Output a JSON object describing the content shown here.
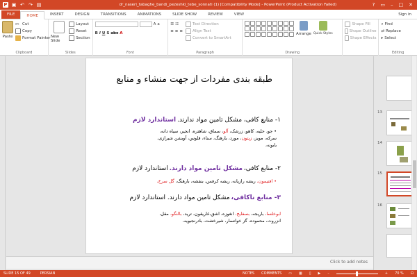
{
  "window": {
    "title": "dr_naseri_tabaghe_bandi_pezeshki_tebe_sonnati (1) [Compatibility Mode] - PowerPoint (Product Activation Failed)",
    "controls": [
      "?",
      "▭",
      "–",
      "□",
      "✕"
    ]
  },
  "quick_access": {
    "icons": [
      "save-icon",
      "undo-icon",
      "redo-icon",
      "present-icon"
    ]
  },
  "tabs": [
    "FILE",
    "HOME",
    "INSERT",
    "DESIGN",
    "TRANSITIONS",
    "ANIMATIONS",
    "SLIDE SHOW",
    "REVIEW",
    "VIEW"
  ],
  "active_tab": "HOME",
  "sign_in": "Sign in",
  "ribbon": {
    "clipboard": {
      "paste": "Paste",
      "cut": "Cut",
      "copy": "Copy",
      "format_painter": "Format Painter",
      "label": "Clipboard"
    },
    "slides": {
      "new_slide": "New Slide",
      "layout": "Layout",
      "reset": "Reset",
      "section": "Section",
      "label": "Slides"
    },
    "font": {
      "label": "Font"
    },
    "paragraph": {
      "text_direction": "Text Direction",
      "align_text": "Align Text",
      "convert_smartart": "Convert to SmartArt",
      "label": "Paragraph"
    },
    "drawing": {
      "arrange": "Arrange",
      "quick_styles": "Quick Styles",
      "shape_fill": "Shape Fill",
      "shape_outline": "Shape Outline",
      "shape_effects": "Shape Effects",
      "label": "Drawing"
    },
    "editing": {
      "find": "Find",
      "replace": "Replace",
      "select": "Select",
      "label": "Editing"
    }
  },
  "slide": {
    "title": "طبقه بندی مفردات از جهت منشاء و منابع",
    "p1_head_a": "۱- منابع کافی، مشکل تامین مواد ندارند.",
    "p1_head_b": "استاندارد لازم",
    "p1_b1_a": "• جو، حلیه، کاهو، زرشک،",
    "p1_b1_red": "آلو",
    "p1_b1_c": "، سماق، شاهتره، انجیر، سیاه دانه،",
    "p1_b2_a": "سرکه، مویز،",
    "p1_b2_red": "زیتون",
    "p1_b2_c": "، مورد، بارهنگ، سناء، قلوس، آویشن شیرازی،",
    "p1_b3": "بابونه،",
    "p2_head_a": "۲- منابع کافی،",
    "p2_head_b": "مشکل تامین مواد دارند.",
    "p2_head_c": "استاندارد لازم",
    "p2_b1_red": "• افتیمون،",
    "p2_b1_b": "ریشه رازیانه، ریشه کرفس، بنفشه، بارهنگ،",
    "p2_b1_red2": "گل سرخ،",
    "p3_head_a": "۳- منابع ناکافی،",
    "p3_head_b": "مشکل تامین مواد دارند. استاندارد لازم",
    "p3_b1_red": "ابوخلسا،",
    "p3_b1_b": "باریجه،",
    "p3_b1_red2": "بسفایج،",
    "p3_b1_c": "انغوزه، اشق،غاریقون، ترید،",
    "p3_b1_red3": "بالنگو،",
    "p3_b1_d": "مقل،",
    "p3_b2": "انزروت، محموده، گز خوانسار، شیرخشت، بادرنجبویه،"
  },
  "notes_placeholder": "Click to add notes",
  "thumbnails": [
    {
      "num": "13",
      "active": false
    },
    {
      "num": "14",
      "active": false
    },
    {
      "num": "15",
      "active": true
    },
    {
      "num": "16",
      "active": false
    }
  ],
  "status": {
    "slide_of": "SLIDE 15 OF 49",
    "language": "PERSIAN",
    "notes": "NOTES",
    "comments": "COMMENTS",
    "zoom": "70 %"
  },
  "colors": {
    "accent": "#d24726",
    "purple": "#7030a0",
    "red": "#e0181b"
  }
}
